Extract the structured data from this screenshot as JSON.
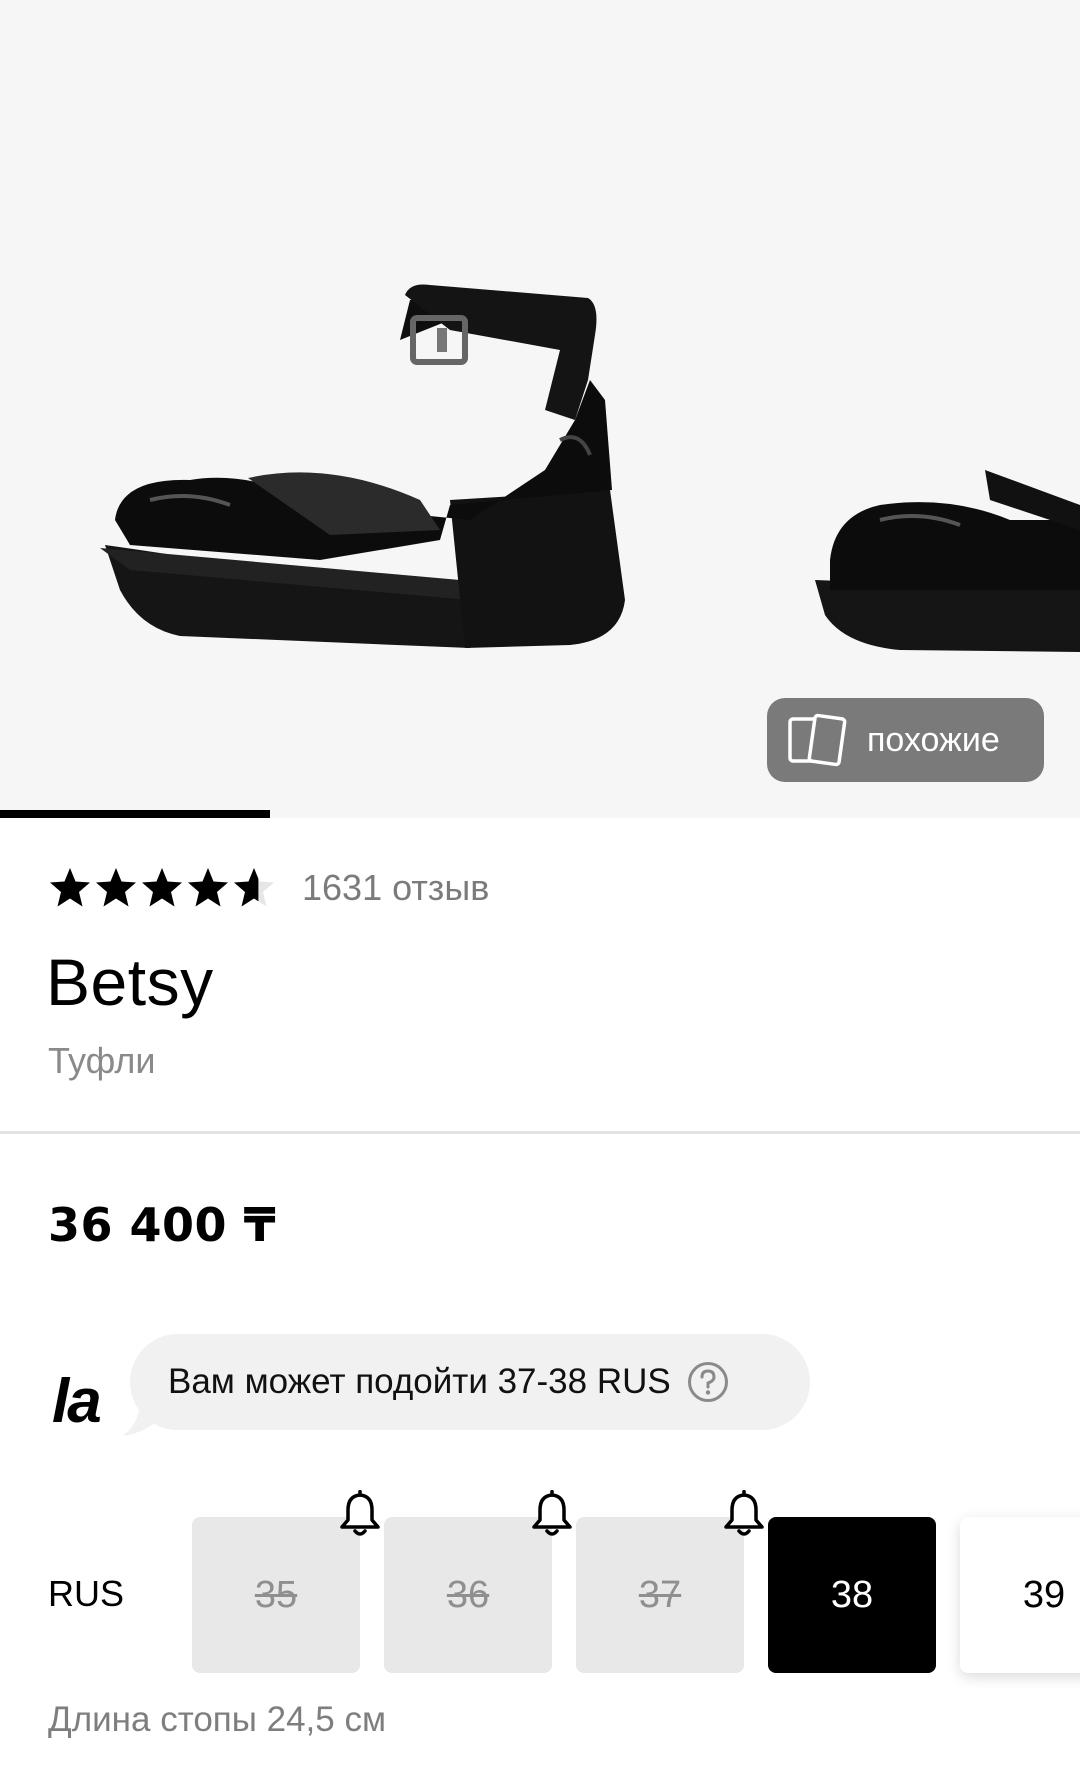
{
  "gallery": {
    "similar_button_label": "похожие",
    "image_progress": 0.25
  },
  "product": {
    "rating": 4.6,
    "review_count_label": "1631 отзыв",
    "brand": "Betsy",
    "category": "Туфли",
    "price": "36 400 ₸"
  },
  "fit": {
    "logo_text": "la",
    "recommendation": "Вам может подойти 37-38 RUS"
  },
  "sizes": {
    "system_label": "RUS",
    "items": [
      {
        "label": "35",
        "available": false,
        "notify": true
      },
      {
        "label": "36",
        "available": false,
        "notify": true
      },
      {
        "label": "37",
        "available": false,
        "notify": true
      },
      {
        "label": "38",
        "available": true,
        "selected": true
      },
      {
        "label": "39",
        "available": true,
        "selected": false
      }
    ],
    "foot_length": "Длина стопы 24,5 см"
  },
  "colors": {
    "accent": "#000000",
    "muted_text": "#7b7b7b",
    "unavailable_bg": "#e8e8e8",
    "button_bg": "#7a7a7a"
  },
  "icons": [
    "star-icon",
    "cards-icon",
    "help-icon",
    "bell-icon"
  ]
}
